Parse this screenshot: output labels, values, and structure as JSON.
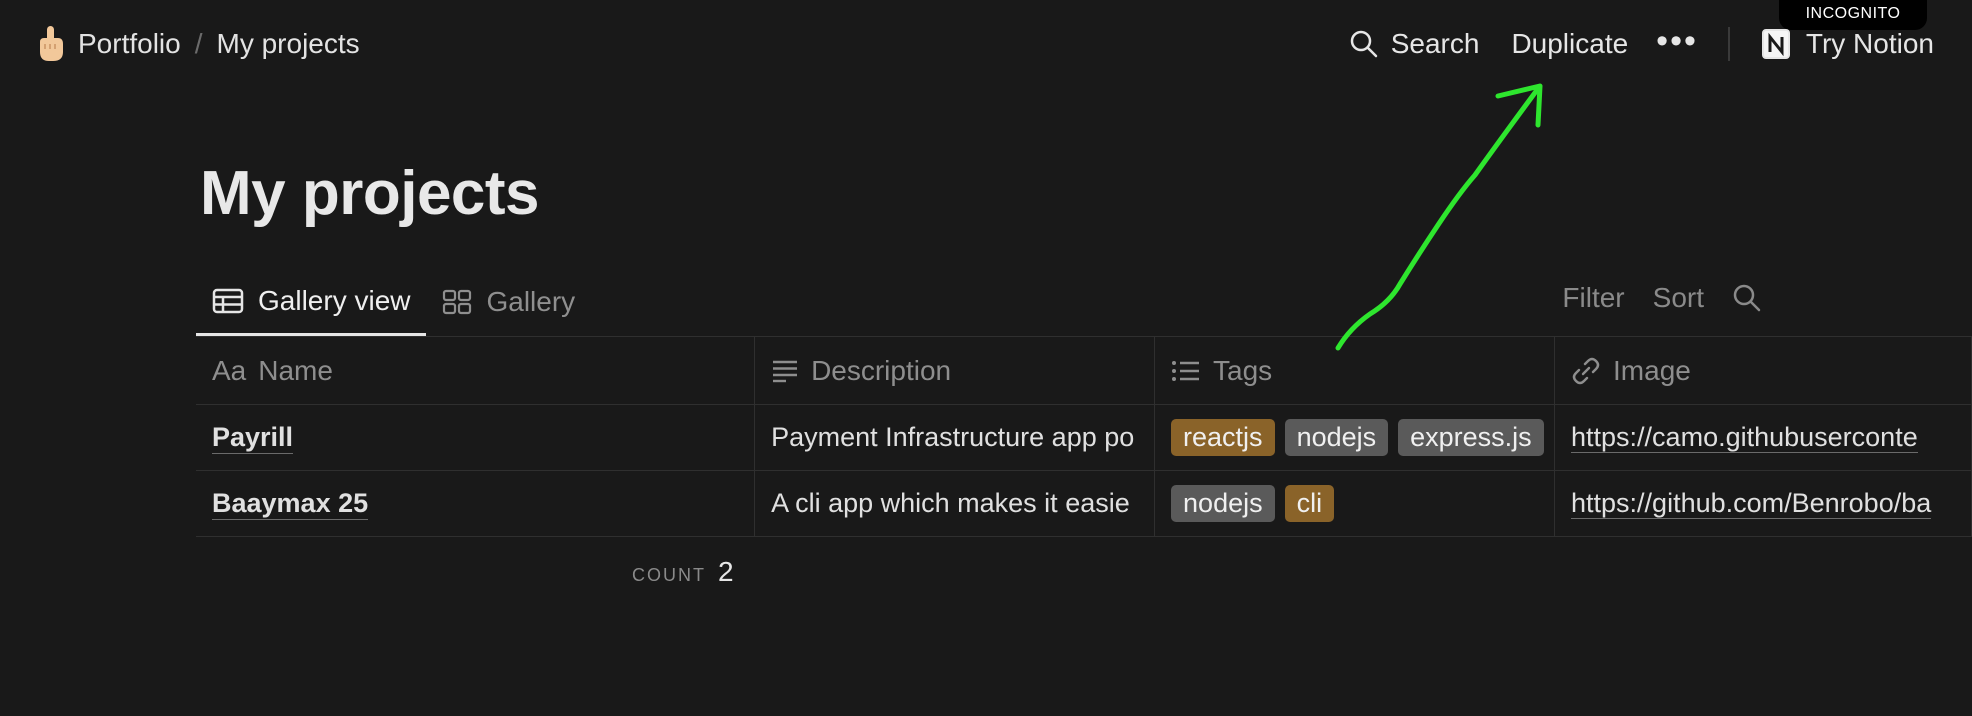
{
  "incognito_label": "INCOGNITO",
  "breadcrumb": {
    "emoji_icon": "pointing-up-hand-icon",
    "parent": "Portfolio",
    "separator": "/",
    "current": "My projects"
  },
  "topbar": {
    "search_label": "Search",
    "duplicate_label": "Duplicate",
    "more_label": "•••",
    "try_notion_label": "Try Notion"
  },
  "page": {
    "title": "My projects"
  },
  "tabs": [
    {
      "label": "Gallery view",
      "icon": "table-icon",
      "active": true
    },
    {
      "label": "Gallery",
      "icon": "gallery-grid-icon",
      "active": false
    }
  ],
  "view_actions": {
    "filter": "Filter",
    "sort": "Sort"
  },
  "table": {
    "columns": [
      {
        "prefix": "Aa",
        "label": "Name"
      },
      {
        "label": "Description",
        "icon": "text-lines-icon"
      },
      {
        "label": "Tags",
        "icon": "list-icon"
      },
      {
        "label": "Image",
        "icon": "link-icon"
      }
    ],
    "rows": [
      {
        "name": "Payrill",
        "description": "Payment Infrastructure app po",
        "tags": [
          {
            "label": "reactjs",
            "color": "#8a6329"
          },
          {
            "label": "nodejs",
            "color": "#5a5a5a"
          },
          {
            "label": "express.js",
            "color": "#5a5a5a"
          }
        ],
        "image": "https://camo.githubuserconte"
      },
      {
        "name": "Baaymax 25",
        "description": "A cli app which makes it easie",
        "tags": [
          {
            "label": "nodejs",
            "color": "#5a5a5a"
          },
          {
            "label": "cli",
            "color": "#8a6329"
          }
        ],
        "image": "https://github.com/Benrobo/ba"
      }
    ]
  },
  "count": {
    "label": "COUNT",
    "value": "2"
  },
  "colors": {
    "background": "#191919",
    "annotation_arrow": "#2ee62e"
  }
}
